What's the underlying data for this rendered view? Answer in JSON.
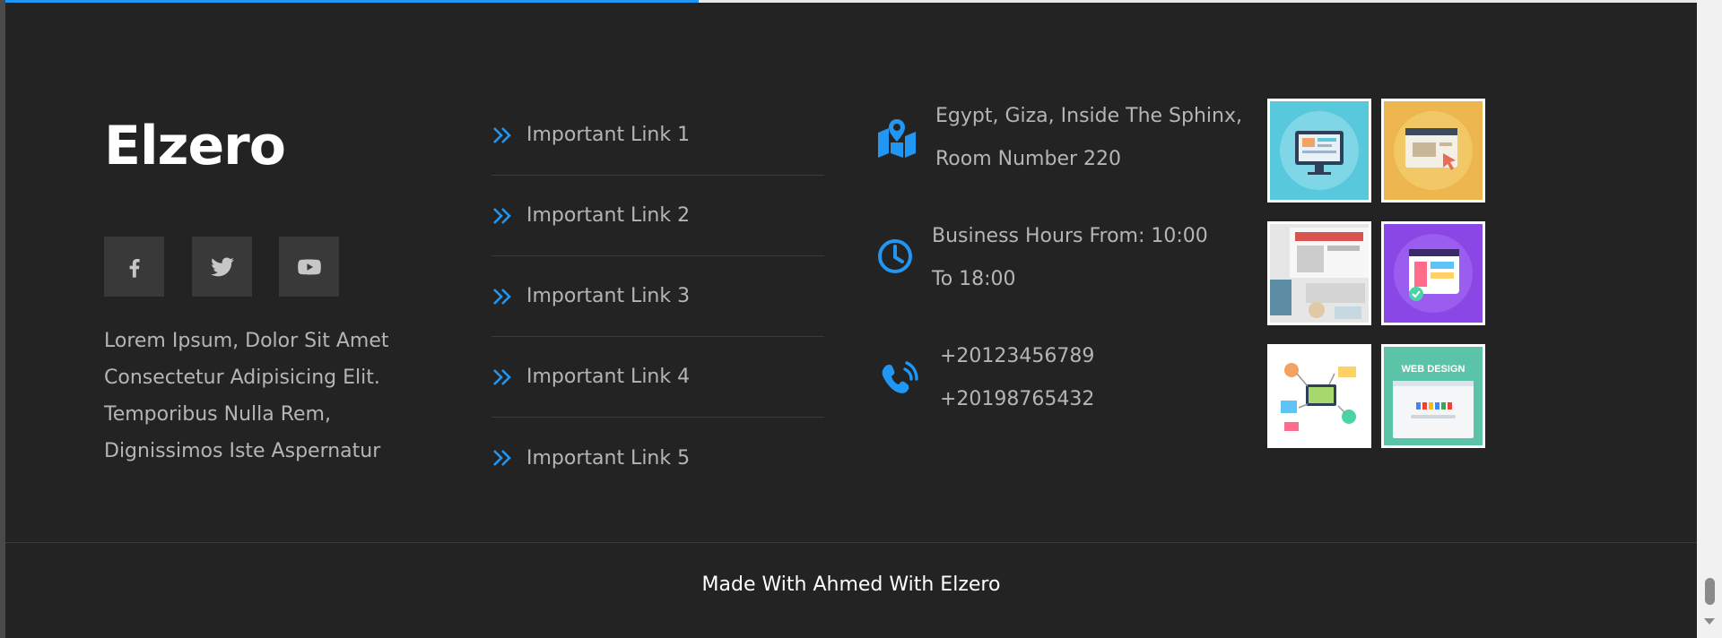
{
  "brand": {
    "name": "Elzero"
  },
  "social": [
    {
      "name": "facebook-icon"
    },
    {
      "name": "twitter-icon"
    },
    {
      "name": "youtube-icon"
    }
  ],
  "about": {
    "text": "Lorem Ipsum, Dolor Sit Amet Consectetur Adipisicing Elit. Temporibus Nulla Rem, Dignissimos Iste Aspernatur"
  },
  "links": [
    {
      "label": "Important Link 1"
    },
    {
      "label": "Important Link 2"
    },
    {
      "label": "Important Link 3"
    },
    {
      "label": "Important Link 4"
    },
    {
      "label": "Important Link 5"
    }
  ],
  "contact": {
    "address": {
      "line1": "Egypt, Giza, Inside The Sphinx,",
      "line2": "Room Number 220"
    },
    "hours": {
      "line1": "Business Hours From: 10:00",
      "line2": "To 18:00"
    },
    "phones": {
      "line1": "+20123456789",
      "line2": "+20198765432"
    }
  },
  "gallery": [
    {
      "icon": "desktop-illustration"
    },
    {
      "icon": "browser-cursor-illustration"
    },
    {
      "icon": "workspace-photo"
    },
    {
      "icon": "app-ui-illustration"
    },
    {
      "icon": "marketing-illustration"
    },
    {
      "icon": "web-design-thumbnail",
      "caption": "WEB DESIGN"
    }
  ],
  "footer": {
    "credit": "Made With Ahmed With Elzero"
  },
  "progress": {
    "percent": 41
  },
  "colors": {
    "accent": "#2196f3",
    "background": "#232323",
    "text_muted": "#b5b5b5",
    "social_bg": "#393939"
  }
}
